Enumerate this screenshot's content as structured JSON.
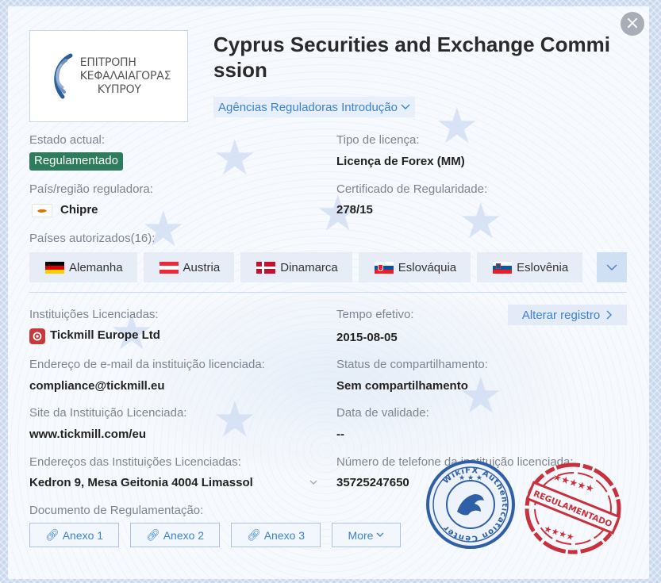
{
  "header": {
    "title": "Cyprus Securities and Exchange Commission",
    "intro_link": "Agências Reguladoras Introdução",
    "logo_lines": [
      "ΕΠΙΤΡΟΠΗ",
      "ΚΕΦΑΛΑΙΑΓΟΡΑΣ",
      "ΚΥΠΡΟΥ"
    ]
  },
  "fields": {
    "estado_label": "Estado actual:",
    "estado_value": "Regulamentado",
    "tipo_label": "Tipo de licença:",
    "tipo_value": "Licença de Forex (MM)",
    "pais_label": "País/região reguladora:",
    "pais_value": "Chipre",
    "cert_label": "Certificado de Regularidade:",
    "cert_value": "278/15",
    "paises_label": "Países autorizados(16):"
  },
  "countries": [
    {
      "name": "Alemanha",
      "flag": "germany-flag-icon"
    },
    {
      "name": "Austria",
      "flag": "austria-flag-icon"
    },
    {
      "name": "Dinamarca",
      "flag": "denmark-flag-icon"
    },
    {
      "name": "Eslováquia",
      "flag": "slovakia-flag-icon"
    },
    {
      "name": "Eslovênia",
      "flag": "slovenia-flag-icon"
    }
  ],
  "institution": {
    "inst_label": "Instituições Licenciadas:",
    "inst_value": "Tickmill Europe Ltd",
    "tempo_label": "Tempo efetivo:",
    "tempo_value": "2015-08-05",
    "alter_label": "Alterar registro",
    "email_label": "Endereço de e-mail da instituição licenciada:",
    "email_value": "compliance@tickmill.eu",
    "status_label": "Status de compartilhamento:",
    "status_value": "Sem compartilhamento",
    "site_label": "Site da Instituição Licenciada:",
    "site_value": "www.tickmill.com/eu",
    "validade_label": "Data de validade:",
    "validade_value": "--",
    "addr_label": "Endereços das Instituições Licenciadas:",
    "addr_value": "Kedron 9, Mesa Geitonia 4004 Limassol",
    "phone_label": "Número de telefone da instituição licenciada:",
    "phone_value": "35725247650"
  },
  "docs": {
    "label": "Documento de Regulamentação:",
    "items": [
      "Anexo 1",
      "Anexo 2",
      "Anexo 3"
    ],
    "more": "More"
  },
  "seals": {
    "wikifx": "WikiFX Authentication Center",
    "regulated": "REGULAMENTADO"
  },
  "colors": {
    "accent": "#3d82d0",
    "badge": "#2e7c5e",
    "seal_blue": "#2f5fa6",
    "seal_red": "#c8313b"
  }
}
